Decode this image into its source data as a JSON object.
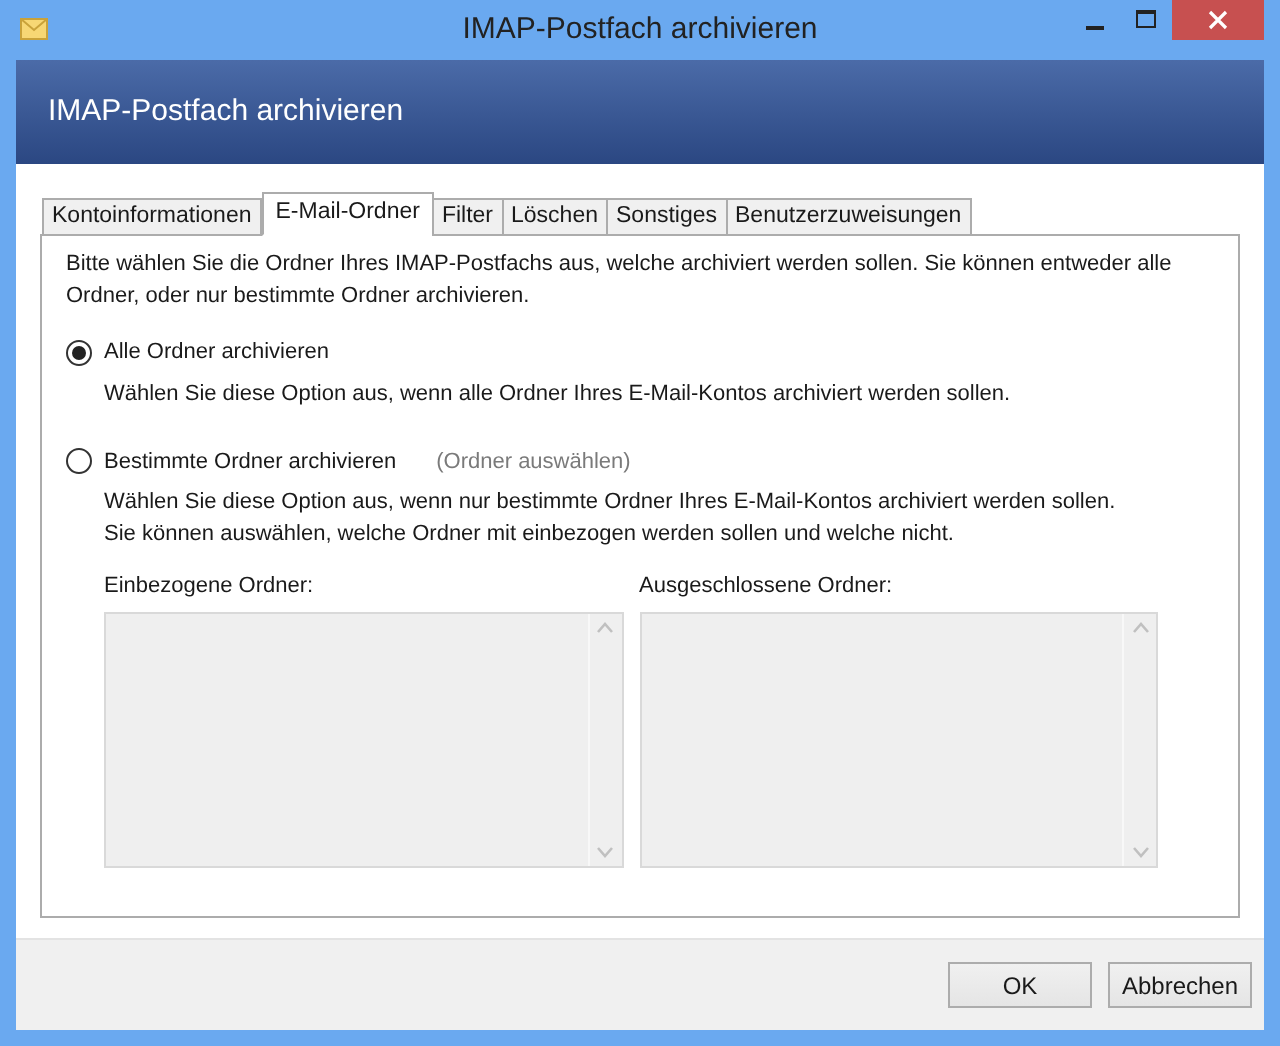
{
  "window": {
    "title": "IMAP-Postfach archivieren"
  },
  "header": {
    "title": "IMAP-Postfach archivieren"
  },
  "tabs": [
    {
      "label": "Kontoinformationen",
      "selected": false
    },
    {
      "label": "E-Mail-Ordner",
      "selected": true
    },
    {
      "label": "Filter",
      "selected": false
    },
    {
      "label": "Löschen",
      "selected": false
    },
    {
      "label": "Sonstiges",
      "selected": false
    },
    {
      "label": "Benutzerzuweisungen",
      "selected": false
    }
  ],
  "intro": "Bitte wählen Sie die Ordner Ihres IMAP-Postfachs aus, welche archiviert werden sollen. Sie können entweder alle Ordner, oder nur bestimmte Ordner archivieren.",
  "options": [
    {
      "label": "Alle Ordner archivieren",
      "selected": true,
      "description": "Wählen Sie diese Option aus, wenn alle Ordner Ihres E-Mail-Kontos archiviert werden sollen."
    },
    {
      "label": "Bestimmte Ordner archivieren",
      "selected": false,
      "link": {
        "label": "(Ordner auswählen)",
        "disabled": true
      },
      "description": "Wählen Sie diese Option aus, wenn nur bestimmte Ordner Ihres E-Mail-Kontos archiviert werden sollen. Sie können auswählen, welche Ordner mit einbezogen werden sollen und welche nicht."
    }
  ],
  "lists": [
    {
      "label": "Einbezogene Ordner:",
      "disabled": true
    },
    {
      "label": "Ausgeschlossene Ordner:",
      "disabled": true
    }
  ],
  "buttons": [
    "OK",
    "Abbrechen"
  ]
}
